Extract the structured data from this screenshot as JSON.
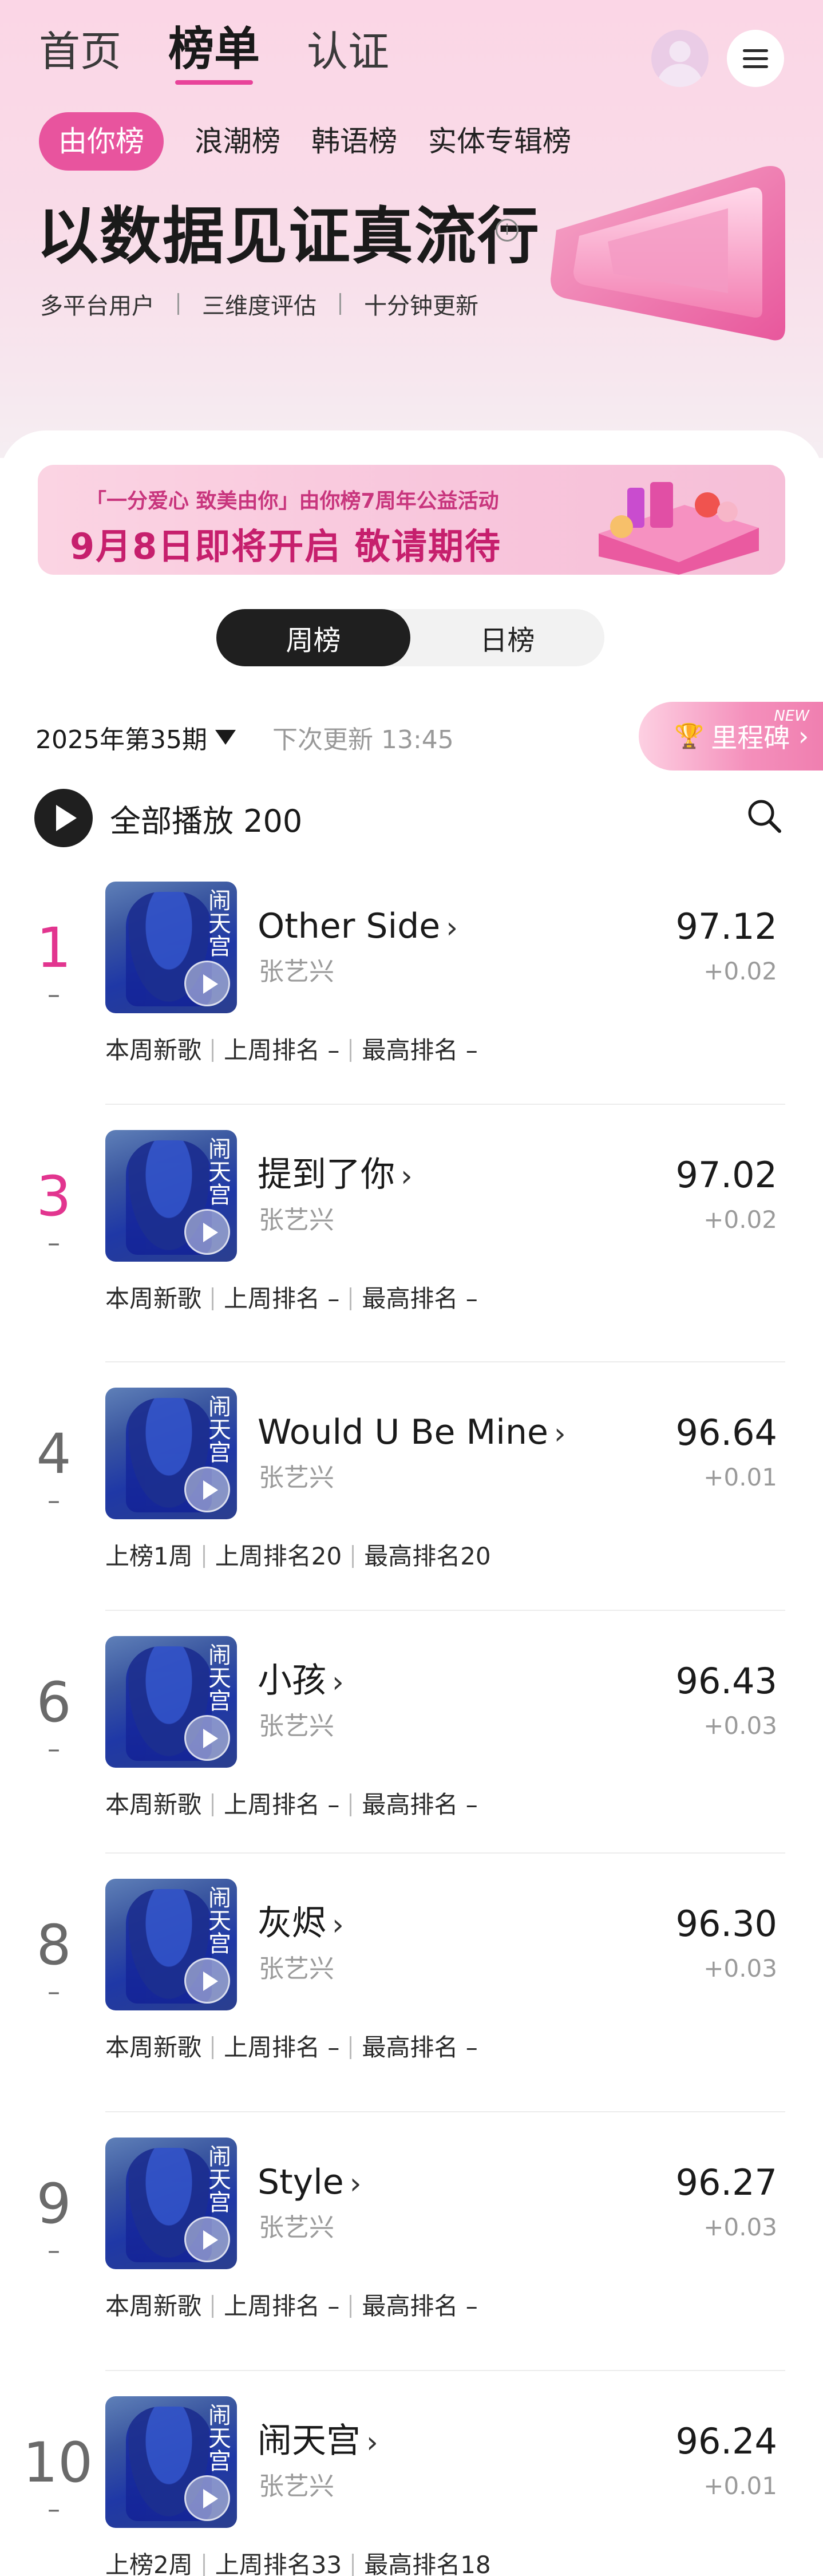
{
  "nav": {
    "tabs": [
      "首页",
      "榜单",
      "认证"
    ],
    "active_tab": "榜单"
  },
  "subtabs": [
    "由你榜",
    "浪潮榜",
    "韩语榜",
    "实体专辑榜"
  ],
  "hero": {
    "headline": "以数据见证真流行",
    "info_icon": "info-icon",
    "taglines": [
      "多平台用户",
      "三维度评估",
      "十分钟更新"
    ]
  },
  "banner": {
    "line1": "「一分爱心 致美由你」由你榜7周年公益活动",
    "line2": "9月8日即将开启 敬请期待"
  },
  "toggle": {
    "weekly": "周榜",
    "daily": "日榜",
    "active": "周榜"
  },
  "issue": {
    "label": "2025年第35期",
    "next_update": "下次更新 13:45",
    "milestone": "里程碑",
    "milestone_badge": "NEW"
  },
  "playall": {
    "label": "全部播放",
    "count": "200"
  },
  "songs": [
    {
      "rank": "1",
      "trend": "–",
      "title": "Other Side",
      "artist": "张艺兴",
      "score": "97.12",
      "delta": "+0.02",
      "meta": [
        "本周新歌",
        "上周排名 –",
        "最高排名 –"
      ],
      "hot": true
    },
    {
      "rank": "3",
      "trend": "–",
      "title": "提到了你",
      "artist": "张艺兴",
      "score": "97.02",
      "delta": "+0.02",
      "meta": [
        "本周新歌",
        "上周排名 –",
        "最高排名 –"
      ],
      "hot": true
    },
    {
      "rank": "4",
      "trend": "–",
      "title": "Would U Be Mine",
      "artist": "张艺兴",
      "score": "96.64",
      "delta": "+0.01",
      "meta": [
        "上榜1周",
        "上周排名20",
        "最高排名20"
      ],
      "hot": false
    },
    {
      "rank": "6",
      "trend": "–",
      "title": "小孩",
      "artist": "张艺兴",
      "score": "96.43",
      "delta": "+0.03",
      "meta": [
        "本周新歌",
        "上周排名 –",
        "最高排名 –"
      ],
      "hot": false
    },
    {
      "rank": "8",
      "trend": "–",
      "title": "灰烬",
      "artist": "张艺兴",
      "score": "96.30",
      "delta": "+0.03",
      "meta": [
        "本周新歌",
        "上周排名 –",
        "最高排名 –"
      ],
      "hot": false
    },
    {
      "rank": "9",
      "trend": "–",
      "title": "Style",
      "artist": "张艺兴",
      "score": "96.27",
      "delta": "+0.03",
      "meta": [
        "本周新歌",
        "上周排名 –",
        "最高排名 –"
      ],
      "hot": false
    },
    {
      "rank": "10",
      "trend": "–",
      "title": "闹天宫",
      "artist": "张艺兴",
      "score": "96.24",
      "delta": "+0.01",
      "meta": [
        "上榜2周",
        "上周排名33",
        "最高排名18"
      ],
      "hot": false
    }
  ],
  "cover_glyph": "闹天宫",
  "colors": {
    "accent": "#e8549e",
    "rank_hot": "#e2358f",
    "dark": "#1f1f1f"
  }
}
